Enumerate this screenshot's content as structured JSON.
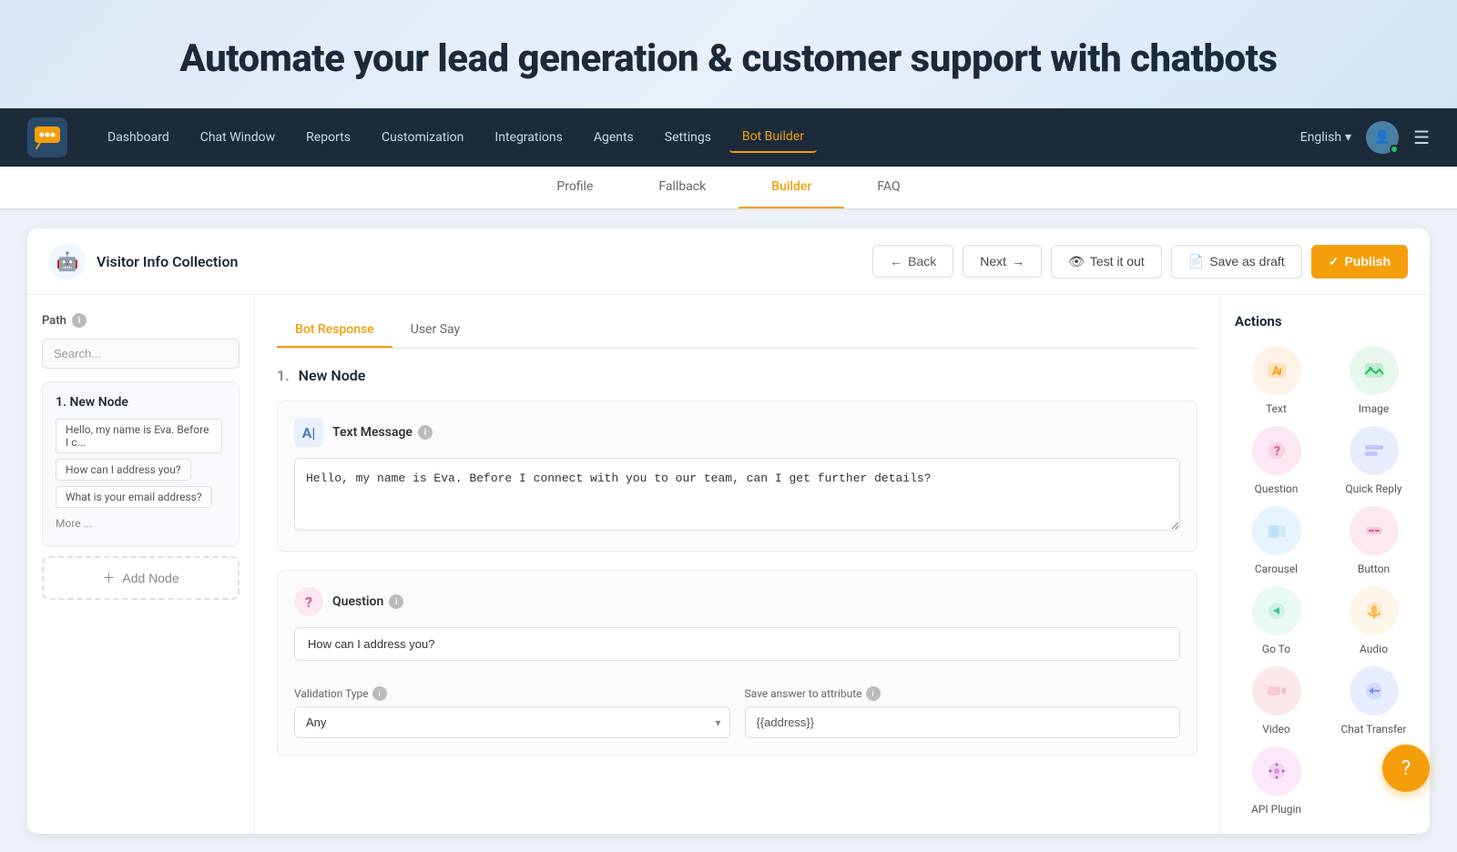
{
  "hero": {
    "title": "Automate your lead generation & customer support with chatbots"
  },
  "navbar": {
    "logo_alt": "ChatBot Logo",
    "items": [
      {
        "label": "Dashboard",
        "active": false
      },
      {
        "label": "Chat Window",
        "active": false
      },
      {
        "label": "Reports",
        "active": false
      },
      {
        "label": "Customization",
        "active": false
      },
      {
        "label": "Integrations",
        "active": false
      },
      {
        "label": "Agents",
        "active": false
      },
      {
        "label": "Settings",
        "active": false
      },
      {
        "label": "Bot Builder",
        "active": true
      }
    ],
    "language": "English",
    "menu_icon": "☰"
  },
  "sub_tabs": [
    {
      "label": "Profile",
      "active": false
    },
    {
      "label": "Fallback",
      "active": false
    },
    {
      "label": "Builder",
      "active": true
    },
    {
      "label": "FAQ",
      "active": false
    }
  ],
  "bot_card": {
    "bot_name": "Visitor Info Collection",
    "back_label": "Back",
    "next_label": "Next",
    "test_label": "Test it out",
    "draft_label": "Save as draft",
    "publish_label": "Publish"
  },
  "path": {
    "label": "Path",
    "search_placeholder": "Search...",
    "node": {
      "title": "1. New Node",
      "tags": [
        "Hello, my name is Eva. Before I c...",
        "How can I address you?",
        "What is your email address?"
      ],
      "more": "More ..."
    },
    "add_node_label": "Add Node"
  },
  "center": {
    "tabs": [
      {
        "label": "Bot Response",
        "active": true
      },
      {
        "label": "User Say",
        "active": false
      }
    ],
    "node_title": "New Node",
    "node_number": "1.",
    "text_message": {
      "label": "Text Message",
      "icon": "A|",
      "content": "Hello, my name is Eva. Before I connect with you to our team, can I get further details?"
    },
    "question": {
      "label": "Question",
      "icon": "?",
      "content": "How can I address you?",
      "validation_label": "Validation Type",
      "validation_value": "Any",
      "save_label": "Save answer to attribute",
      "save_value": "{{address}}"
    }
  },
  "actions": {
    "title": "Actions",
    "items": [
      {
        "label": "Text",
        "icon": "A",
        "icon_class": "icon-text",
        "color": "#f59e0b"
      },
      {
        "label": "Image",
        "icon": "🖼",
        "icon_class": "icon-image"
      },
      {
        "label": "Question",
        "icon": "?",
        "icon_class": "icon-question",
        "color": "#e05580"
      },
      {
        "label": "Quick Reply",
        "icon": "≡",
        "icon_class": "icon-quickreply",
        "color": "#5b6ef5"
      },
      {
        "label": "Carousel",
        "icon": "⊞",
        "icon_class": "icon-carousel",
        "color": "#3ab5e5"
      },
      {
        "label": "Button",
        "icon": "▣",
        "icon_class": "icon-button",
        "color": "#e05580"
      },
      {
        "label": "Go To",
        "icon": "↗",
        "icon_class": "icon-goto",
        "color": "#3ac5a0"
      },
      {
        "label": "Audio",
        "icon": "🎙",
        "icon_class": "icon-audio"
      },
      {
        "label": "Video",
        "icon": "📹",
        "icon_class": "icon-video"
      },
      {
        "label": "Chat Transfer",
        "icon": "↔",
        "icon_class": "icon-chat",
        "color": "#5b6ef5"
      },
      {
        "label": "API Plugin",
        "icon": "⚙",
        "icon_class": "icon-api",
        "color": "#c05bc0"
      }
    ]
  },
  "help": {
    "icon": "?"
  }
}
